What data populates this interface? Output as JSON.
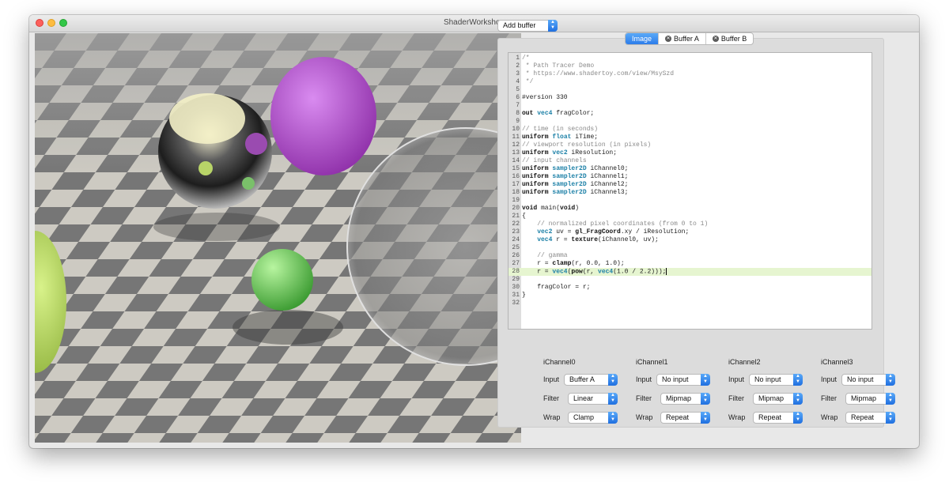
{
  "window": {
    "title": "ShaderWorkshop"
  },
  "toolbar": {
    "add_buffer": "Add buffer"
  },
  "tabs": [
    {
      "label": "Image",
      "active": true,
      "closable": false
    },
    {
      "label": "Buffer A",
      "active": false,
      "closable": true
    },
    {
      "label": "Buffer B",
      "active": false,
      "closable": true
    }
  ],
  "editor": {
    "current_line": 28,
    "lines": [
      "/*",
      " * Path Tracer Demo",
      " * https://www.shadertoy.com/view/MsySzd",
      " */",
      "",
      "#version 330",
      "",
      "out vec4 fragColor;",
      "",
      "// time (in seconds)",
      "uniform float iTime;",
      "// viewport resolution (in pixels)",
      "uniform vec2 iResolution;",
      "// input channels",
      "uniform sampler2D iChannel0;",
      "uniform sampler2D iChannel1;",
      "uniform sampler2D iChannel2;",
      "uniform sampler2D iChannel3;",
      "",
      "void main(void)",
      "{",
      "    // normalized pixel coordinates (from 0 to 1)",
      "    vec2 uv = gl_FragCoord.xy / iResolution;",
      "    vec4 r = texture(iChannel0, uv);",
      "",
      "    // gamma",
      "    r = clamp(r, 0.0, 1.0);",
      "    r = vec4(pow(r, vec4(1.0 / 2.2)));",
      "",
      "    fragColor = r;",
      "}",
      ""
    ]
  },
  "labels": {
    "input": "Input",
    "filter": "Filter",
    "wrap": "Wrap"
  },
  "channels": [
    {
      "name": "iChannel0",
      "input": "Buffer A",
      "filter": "Linear",
      "wrap": "Clamp"
    },
    {
      "name": "iChannel1",
      "input": "No input",
      "filter": "Mipmap",
      "wrap": "Repeat"
    },
    {
      "name": "iChannel2",
      "input": "No input",
      "filter": "Mipmap",
      "wrap": "Repeat"
    },
    {
      "name": "iChannel3",
      "input": "No input",
      "filter": "Mipmap",
      "wrap": "Repeat"
    }
  ],
  "colors": {
    "accent": "#2c7cea",
    "highlight_line": "#e6f5d0",
    "type_keyword": "#1a7fa6"
  },
  "icons": {
    "tab_close": "close-circle-icon",
    "popup_stepper": "up-down-chevron-icon"
  }
}
